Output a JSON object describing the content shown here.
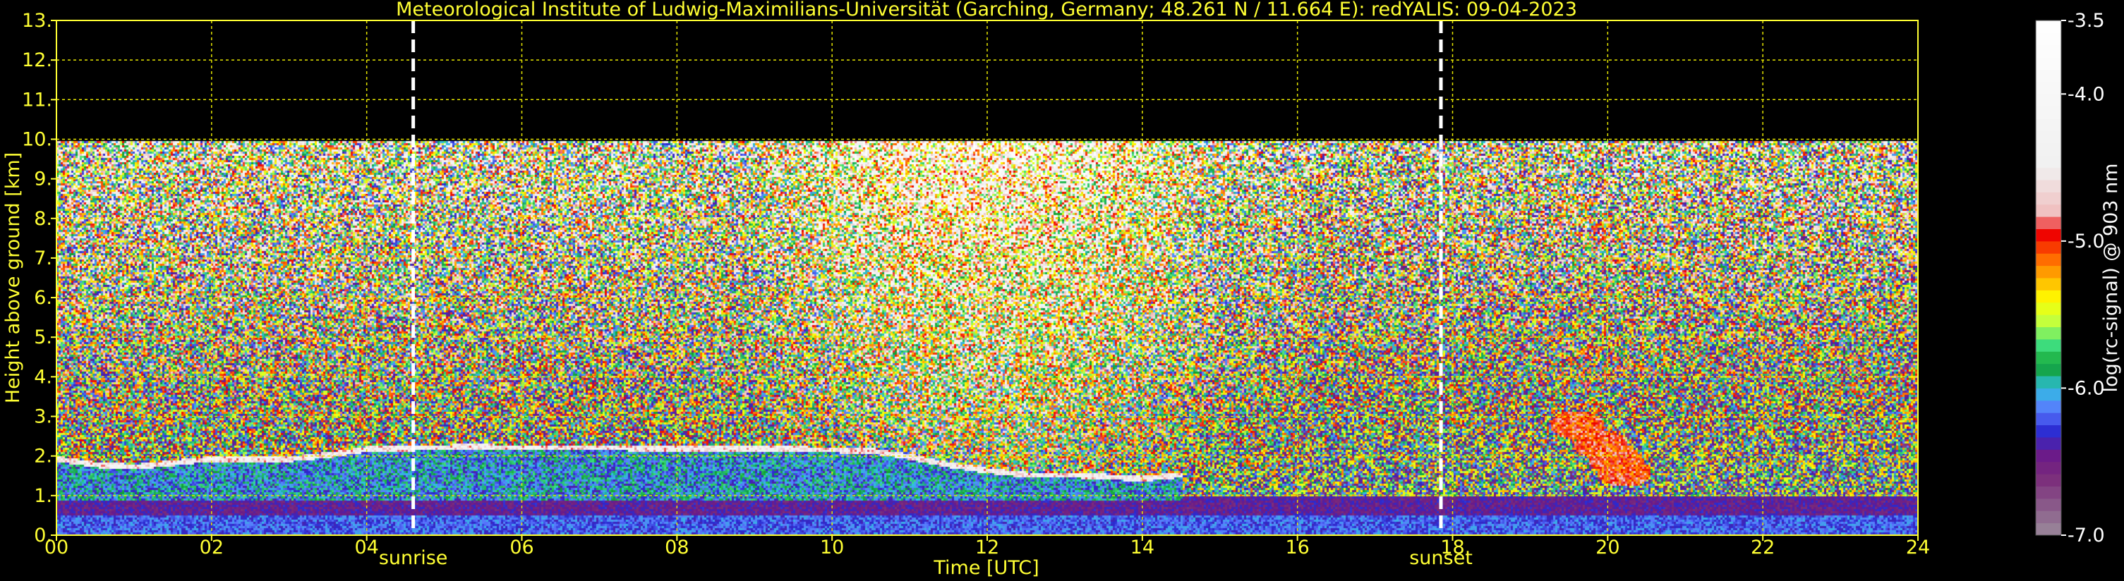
{
  "chart_data": {
    "type": "heatmap",
    "title": "Meteorological Institute of Ludwig-Maximilians-Universität (Garching, Germany; 48.261 N / 11.664 E):    redYALIS: 09-04-2023",
    "xlabel": "Time [UTC]",
    "ylabel": "Height above ground [km]",
    "xlim": [
      0,
      24
    ],
    "ylim": [
      0,
      13
    ],
    "x_ticks": [
      {
        "value": 0,
        "label": "00"
      },
      {
        "value": 2,
        "label": "02"
      },
      {
        "value": 4,
        "label": "04"
      },
      {
        "value": 6,
        "label": "06"
      },
      {
        "value": 8,
        "label": "08"
      },
      {
        "value": 10,
        "label": "10"
      },
      {
        "value": 12,
        "label": "12"
      },
      {
        "value": 14,
        "label": "14"
      },
      {
        "value": 16,
        "label": "16"
      },
      {
        "value": 18,
        "label": "18"
      },
      {
        "value": 20,
        "label": "20"
      },
      {
        "value": 22,
        "label": "22"
      },
      {
        "value": 24,
        "label": "24"
      }
    ],
    "y_ticks": [
      {
        "value": 0,
        "label": "0."
      },
      {
        "value": 1,
        "label": "1."
      },
      {
        "value": 2,
        "label": "2."
      },
      {
        "value": 3,
        "label": "3."
      },
      {
        "value": 4,
        "label": "4."
      },
      {
        "value": 5,
        "label": "5."
      },
      {
        "value": 6,
        "label": "6."
      },
      {
        "value": 7,
        "label": "7."
      },
      {
        "value": 8,
        "label": "8."
      },
      {
        "value": 9,
        "label": "9."
      },
      {
        "value": 10,
        "label": "10."
      },
      {
        "value": 11,
        "label": "11."
      },
      {
        "value": 12,
        "label": "12."
      },
      {
        "value": 13,
        "label": "13."
      }
    ],
    "grid": true,
    "data_ceiling_km": 10,
    "markers": [
      {
        "name": "sunrise",
        "label": "sunrise",
        "x": 4.6
      },
      {
        "name": "sunset",
        "label": "sunset",
        "x": 17.85
      }
    ],
    "colorbar": {
      "label": "log(rc-signal) @ 903 nm",
      "range": [
        -7.0,
        -3.5
      ],
      "ticks": [
        {
          "value": -3.5,
          "label": "-3.5"
        },
        {
          "value": -4.0,
          "label": "-4.0"
        },
        {
          "value": -5.0,
          "label": "-5.0"
        },
        {
          "value": -6.0,
          "label": "-6.0"
        },
        {
          "value": -7.0,
          "label": "-7.0"
        }
      ],
      "stops": [
        {
          "v": -7.0,
          "color": "#9a8a9a"
        },
        {
          "v": -6.8,
          "color": "#8a5a8a"
        },
        {
          "v": -6.6,
          "color": "#7a2a7a"
        },
        {
          "v": -6.45,
          "color": "#6a1a8a"
        },
        {
          "v": -6.3,
          "color": "#2a2ad0"
        },
        {
          "v": -6.15,
          "color": "#5a78ff"
        },
        {
          "v": -6.0,
          "color": "#30c0e0"
        },
        {
          "v": -5.85,
          "color": "#10a030"
        },
        {
          "v": -5.7,
          "color": "#40e080"
        },
        {
          "v": -5.55,
          "color": "#c0ff40"
        },
        {
          "v": -5.4,
          "color": "#ffff00"
        },
        {
          "v": -5.25,
          "color": "#ffb000"
        },
        {
          "v": -5.1,
          "color": "#ff6000"
        },
        {
          "v": -4.95,
          "color": "#ee0000"
        },
        {
          "v": -4.8,
          "color": "#f0c0c0"
        },
        {
          "v": -4.5,
          "color": "#f0f0f0"
        },
        {
          "v": -3.5,
          "color": "#ffffff"
        }
      ]
    },
    "boundary_layer_top_km": [
      {
        "t": 0.0,
        "h": 1.95
      },
      {
        "t": 0.5,
        "h": 1.8
      },
      {
        "t": 1.0,
        "h": 1.75
      },
      {
        "t": 1.5,
        "h": 1.85
      },
      {
        "t": 2.0,
        "h": 1.95
      },
      {
        "t": 2.5,
        "h": 1.95
      },
      {
        "t": 3.0,
        "h": 1.95
      },
      {
        "t": 3.5,
        "h": 2.05
      },
      {
        "t": 4.0,
        "h": 2.2
      },
      {
        "t": 5.2,
        "h": 2.25
      },
      {
        "t": 9.5,
        "h": 2.2
      },
      {
        "t": 10.5,
        "h": 2.15
      },
      {
        "t": 11.0,
        "h": 2.0
      },
      {
        "t": 11.5,
        "h": 1.8
      },
      {
        "t": 12.0,
        "h": 1.65
      },
      {
        "t": 12.5,
        "h": 1.55
      },
      {
        "t": 13.0,
        "h": 1.55
      },
      {
        "t": 13.5,
        "h": 1.5
      },
      {
        "t": 14.0,
        "h": 1.45
      },
      {
        "t": 14.5,
        "h": 1.55
      }
    ],
    "clouds": [
      {
        "t": 19.6,
        "h": 2.8,
        "value": -5.0
      },
      {
        "t": 19.9,
        "h": 2.3,
        "value": -5.0
      },
      {
        "t": 20.1,
        "h": 1.9,
        "value": -5.0
      },
      {
        "t": 20.2,
        "h": 1.6,
        "value": -5.0
      }
    ]
  }
}
